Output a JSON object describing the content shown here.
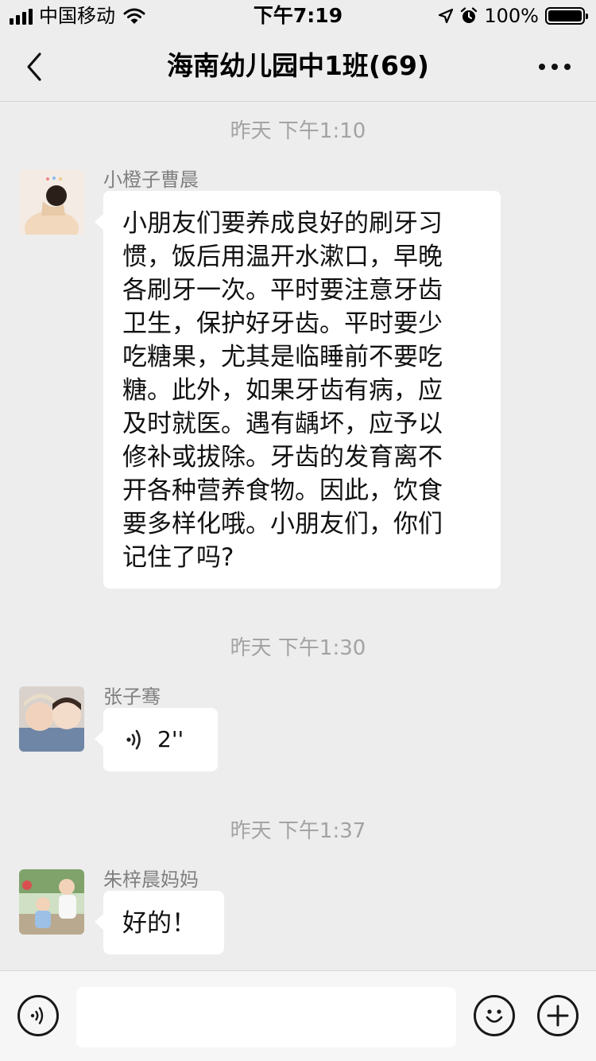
{
  "status_bar": {
    "carrier": "中国移动",
    "time": "下午7:19",
    "battery": "100%"
  },
  "nav": {
    "title": "海南幼儿园中1班(69)",
    "back_icon": "chevron-left-icon",
    "more_icon": "more-dots-icon"
  },
  "messages": [
    {
      "timestamp": "昨天 下午1:10",
      "sender": "小橙子曹晨",
      "text": "小朋友们要养成良好的刷牙习\n惯，饭后用温开水漱口，早晚\n各刷牙一次。平时要注意牙齿\n卫生，保护好牙齿。平时要少\n吃糖果，尤其是临睡前不要吃\n糖。此外，如果牙齿有病，应\n及时就医。遇有龋坏，应予以\n修补或拔除。牙齿的发育离不\n开各种营养食物。因此，饮食\n要多样化哦。小朋友们，你们\n记住了吗?"
    },
    {
      "timestamp": "昨天 下午1:30",
      "sender": "张子骞",
      "voice_duration": "2''"
    },
    {
      "timestamp": "昨天 下午1:37",
      "sender": "朱梓晨妈妈",
      "text": "好的！"
    }
  ],
  "input_bar": {
    "voice_icon": "voice-icon",
    "emoji_icon": "emoji-icon",
    "plus_icon": "plus-icon"
  },
  "colors": {
    "background": "#ededed",
    "bubble": "#ffffff",
    "timestamp": "#a3a3a3",
    "sender": "#7f7f7f"
  }
}
